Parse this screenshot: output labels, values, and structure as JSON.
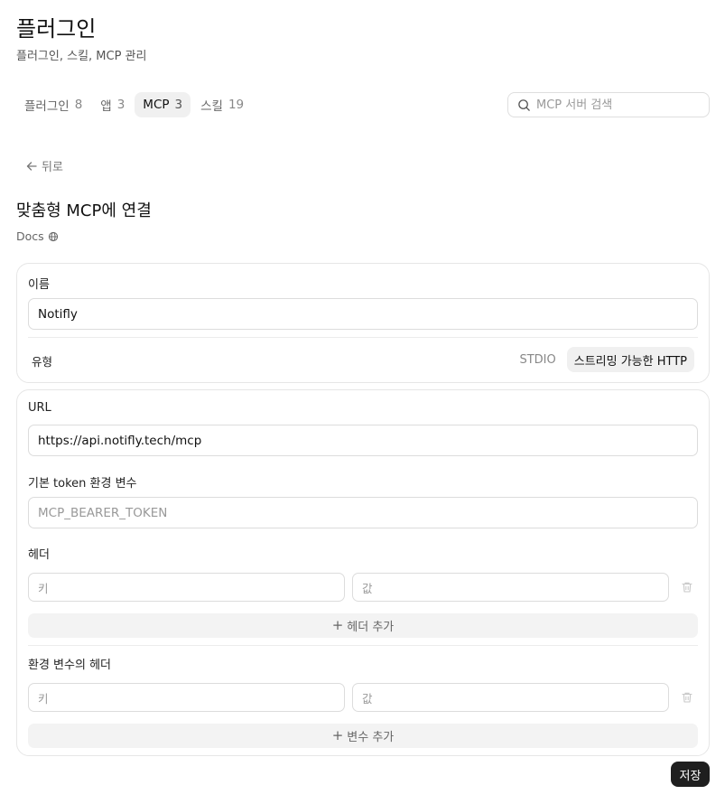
{
  "header": {
    "title": "플러그인",
    "subtitle": "플러그인, 스킬, MCP 관리"
  },
  "tabs": [
    {
      "label": "플러그인",
      "count": "8"
    },
    {
      "label": "앱",
      "count": "3"
    },
    {
      "label": "MCP",
      "count": "3"
    },
    {
      "label": "스킬",
      "count": "19"
    }
  ],
  "search": {
    "placeholder": "MCP 서버 검색"
  },
  "back": {
    "label": "뒤로"
  },
  "form": {
    "title": "맞춤형 MCP에 연결",
    "docs_label": "Docs",
    "name": {
      "label": "이름",
      "value": "Notifly"
    },
    "type": {
      "label": "유형",
      "options": [
        "STDIO",
        "스트리밍 가능한 HTTP"
      ],
      "selected": "스트리밍 가능한 HTTP"
    },
    "url": {
      "label": "URL",
      "value": "https://api.notifly.tech/mcp"
    },
    "token_env": {
      "label": "기본 token 환경 변수",
      "placeholder": "MCP_BEARER_TOKEN"
    },
    "headers": {
      "label": "헤더",
      "key_placeholder": "키",
      "value_placeholder": "값",
      "add_label": "헤더 추가"
    },
    "env_headers": {
      "label": "환경 변수의 헤더",
      "key_placeholder": "키",
      "value_placeholder": "값",
      "add_label": "변수 추가"
    },
    "save_label": "저장"
  }
}
